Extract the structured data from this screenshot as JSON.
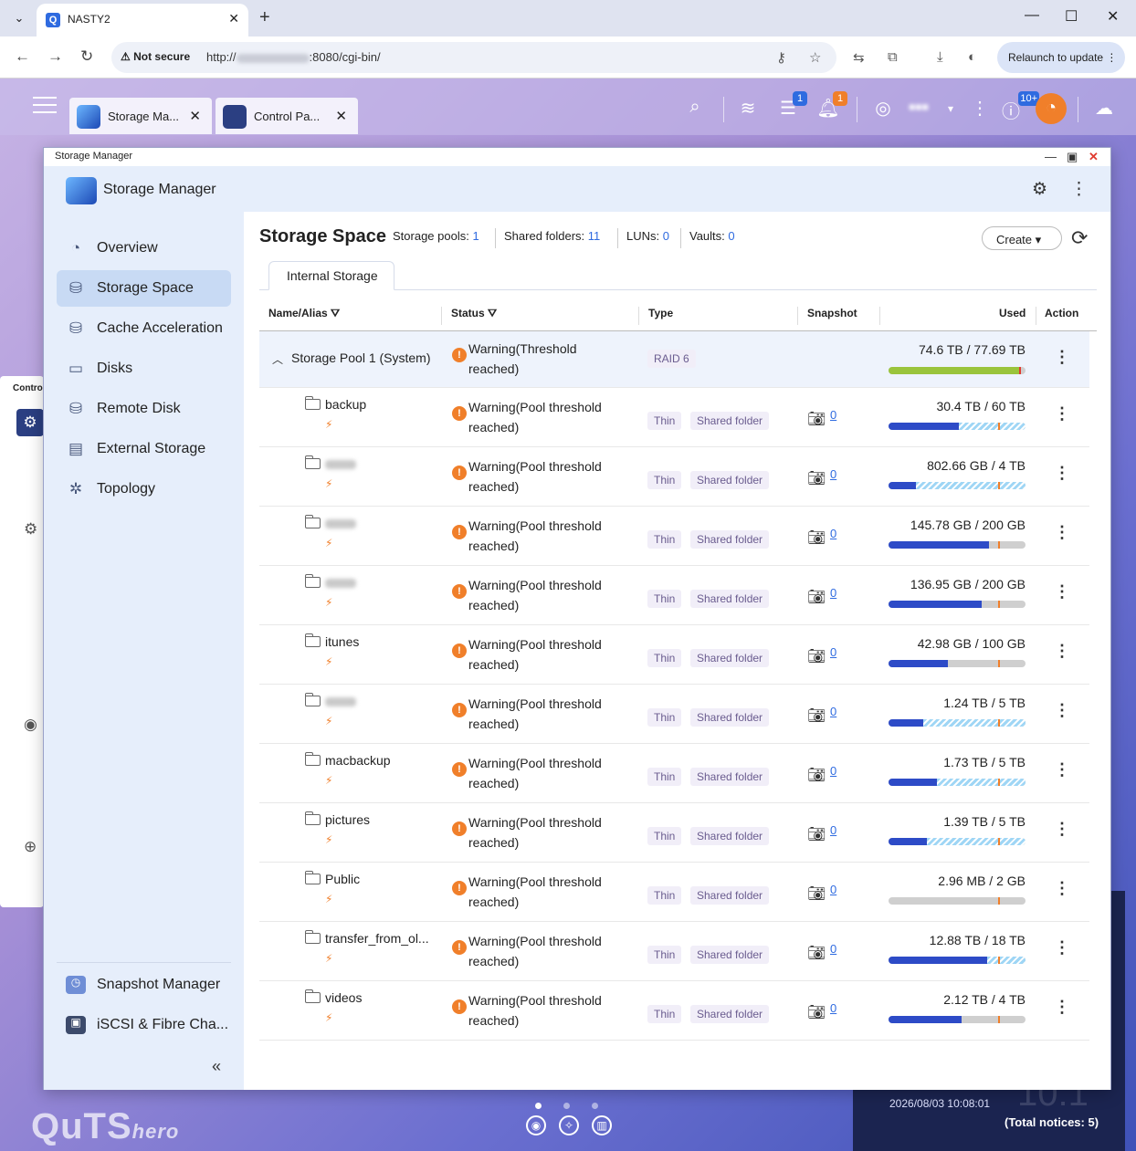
{
  "browser": {
    "tab_title": "NASTY2",
    "tab_favicon": "Q",
    "not_secure": "Not secure",
    "url_prefix": "http://",
    "url_suffix": ":8080/cgi-bin/",
    "relaunch": "Relaunch to update"
  },
  "desktop": {
    "tabs": [
      {
        "label": "Storage Ma...",
        "icon": "storage-manager-icon"
      },
      {
        "label": "Control Pa...",
        "icon": "control-panel-icon"
      }
    ],
    "badges": {
      "tasks": "1",
      "notifications": "1",
      "events": "10+"
    },
    "bg_window_title": "Contro",
    "brand_main": "QuTS",
    "brand_sub": "hero",
    "notice_date": "2026/08/03 10:08:01",
    "notice_total": "(Total notices: 5)"
  },
  "window": {
    "title": "Storage Manager",
    "app_title": "Storage Manager"
  },
  "sidebar": {
    "items": [
      {
        "label": "Overview",
        "icon": "gauge-icon"
      },
      {
        "label": "Storage Space",
        "icon": "database-icon"
      },
      {
        "label": "Cache Acceleration",
        "icon": "cache-icon"
      },
      {
        "label": "Disks",
        "icon": "disk-icon"
      },
      {
        "label": "Remote Disk",
        "icon": "remote-disk-icon"
      },
      {
        "label": "External Storage",
        "icon": "external-storage-icon"
      },
      {
        "label": "Topology",
        "icon": "topology-icon"
      }
    ],
    "bottom": [
      {
        "label": "Snapshot Manager",
        "icon": "snapshot-manager-icon"
      },
      {
        "label": "iSCSI & Fibre Cha...",
        "icon": "iscsi-icon"
      }
    ]
  },
  "main": {
    "title": "Storage Space",
    "stats": {
      "pools_label": "Storage pools:",
      "pools": "1",
      "folders_label": "Shared folders:",
      "folders": "11",
      "luns_label": "LUNs:",
      "luns": "0",
      "vaults_label": "Vaults:",
      "vaults": "0"
    },
    "create": "Create",
    "tab": "Internal Storage",
    "columns": {
      "name": "Name/Alias",
      "status": "Status",
      "type": "Type",
      "snapshot": "Snapshot",
      "used": "Used",
      "action": "Action"
    },
    "pool": {
      "name": "Storage Pool 1 (System)",
      "status": "Warning(Threshold reached)",
      "type": "RAID 6",
      "used": "74.6 TB / 77.69 TB",
      "pct": 0.96
    },
    "folders": [
      {
        "name": "backup",
        "blurred": false,
        "status": "Warning(Pool threshold reached)",
        "thin": "Thin",
        "kind": "Shared folder",
        "snapshots": "0",
        "used": "30.4 TB / 60 TB",
        "pct": 0.51,
        "stripe": true
      },
      {
        "name": "",
        "blurred": true,
        "status": "Warning(Pool threshold reached)",
        "thin": "Thin",
        "kind": "Shared folder",
        "snapshots": "0",
        "used": "802.66 GB / 4 TB",
        "pct": 0.2,
        "stripe": true
      },
      {
        "name": "",
        "blurred": true,
        "status": "Warning(Pool threshold reached)",
        "thin": "Thin",
        "kind": "Shared folder",
        "snapshots": "0",
        "used": "145.78 GB / 200 GB",
        "pct": 0.73,
        "stripe": false
      },
      {
        "name": "",
        "blurred": true,
        "status": "Warning(Pool threshold reached)",
        "thin": "Thin",
        "kind": "Shared folder",
        "snapshots": "0",
        "used": "136.95 GB / 200 GB",
        "pct": 0.68,
        "stripe": false
      },
      {
        "name": "itunes",
        "blurred": false,
        "status": "Warning(Pool threshold reached)",
        "thin": "Thin",
        "kind": "Shared folder",
        "snapshots": "0",
        "used": "42.98 GB / 100 GB",
        "pct": 0.43,
        "stripe": false
      },
      {
        "name": "",
        "blurred": true,
        "status": "Warning(Pool threshold reached)",
        "thin": "Thin",
        "kind": "Shared folder",
        "snapshots": "0",
        "used": "1.24 TB / 5 TB",
        "pct": 0.25,
        "stripe": true
      },
      {
        "name": "macbackup",
        "blurred": false,
        "status": "Warning(Pool threshold reached)",
        "thin": "Thin",
        "kind": "Shared folder",
        "snapshots": "0",
        "used": "1.73 TB / 5 TB",
        "pct": 0.35,
        "stripe": true
      },
      {
        "name": "pictures",
        "blurred": false,
        "status": "Warning(Pool threshold reached)",
        "thin": "Thin",
        "kind": "Shared folder",
        "snapshots": "0",
        "used": "1.39 TB / 5 TB",
        "pct": 0.28,
        "stripe": true
      },
      {
        "name": "Public",
        "blurred": false,
        "status": "Warning(Pool threshold reached)",
        "thin": "Thin",
        "kind": "Shared folder",
        "snapshots": "0",
        "used": "2.96 MB / 2 GB",
        "pct": 0.0,
        "stripe": false
      },
      {
        "name": "transfer_from_ol...",
        "blurred": false,
        "status": "Warning(Pool threshold reached)",
        "thin": "Thin",
        "kind": "Shared folder",
        "snapshots": "0",
        "used": "12.88 TB / 18 TB",
        "pct": 0.72,
        "stripe": true
      },
      {
        "name": "videos",
        "blurred": false,
        "status": "Warning(Pool threshold reached)",
        "thin": "Thin",
        "kind": "Shared folder",
        "snapshots": "0",
        "used": "2.12 TB / 4 TB",
        "pct": 0.53,
        "stripe": false
      }
    ]
  },
  "colors": {
    "accent": "#2f6be0",
    "warning": "#f07f2a",
    "bar_fill": "#2d4bc7",
    "pool_fill": "#9ac43c"
  }
}
